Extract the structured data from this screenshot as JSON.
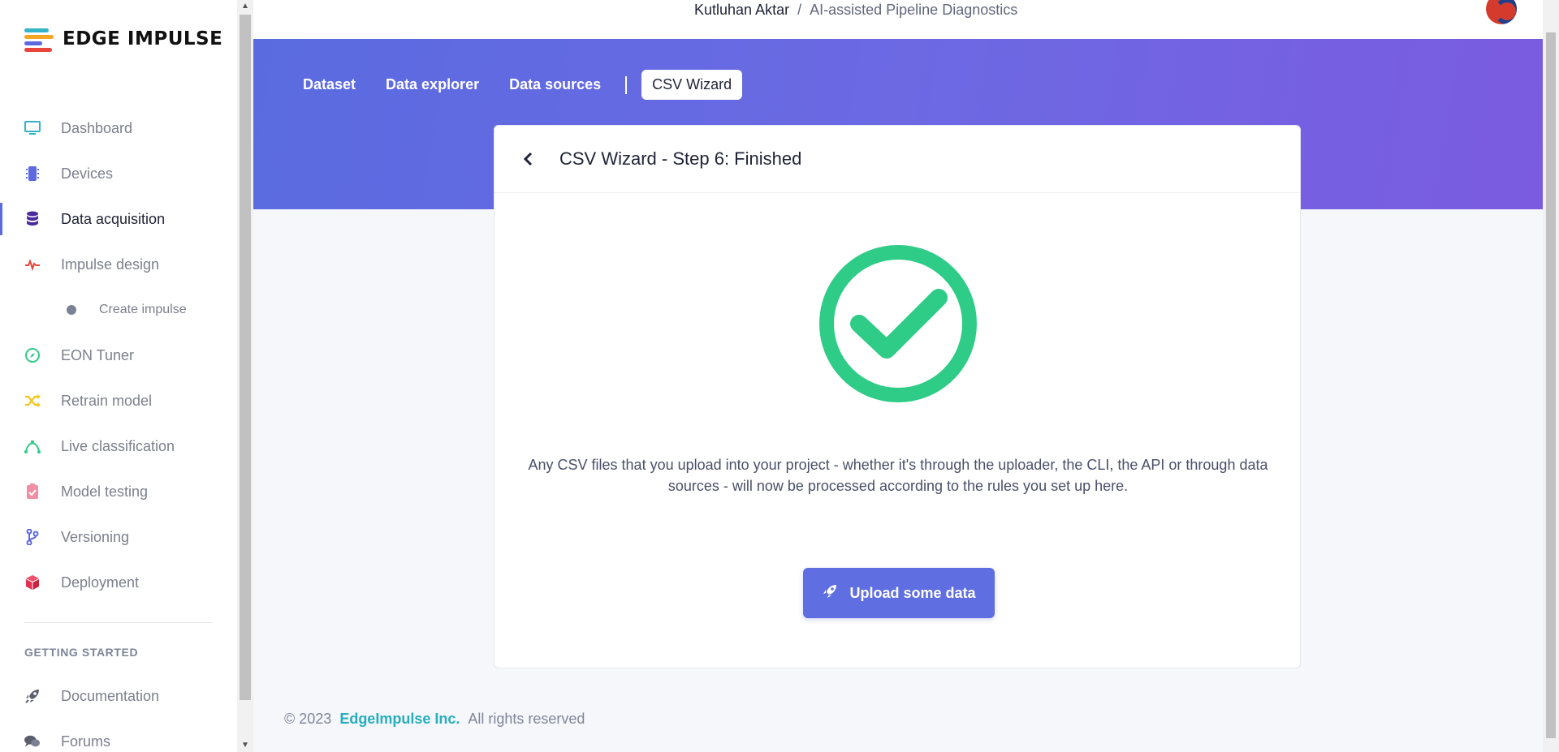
{
  "brand": {
    "name": "EDGE IMPULSE"
  },
  "header": {
    "owner": "Kutluhan Aktar",
    "separator": "/",
    "project": "AI-assisted Pipeline Diagnostics"
  },
  "sidebar": {
    "items": [
      {
        "label": "Dashboard",
        "icon": "monitor-icon"
      },
      {
        "label": "Devices",
        "icon": "chip-icon"
      },
      {
        "label": "Data acquisition",
        "icon": "database-icon"
      },
      {
        "label": "Impulse design",
        "icon": "pulse-icon"
      },
      {
        "label": "Create impulse",
        "icon": "dot-icon"
      },
      {
        "label": "EON Tuner",
        "icon": "compass-icon"
      },
      {
        "label": "Retrain model",
        "icon": "shuffle-icon"
      },
      {
        "label": "Live classification",
        "icon": "bezier-icon"
      },
      {
        "label": "Model testing",
        "icon": "clipboard-check-icon"
      },
      {
        "label": "Versioning",
        "icon": "branch-icon"
      },
      {
        "label": "Deployment",
        "icon": "cube-icon"
      }
    ],
    "section_title": "GETTING STARTED",
    "getting_started": [
      {
        "label": "Documentation",
        "icon": "rocket-icon"
      },
      {
        "label": "Forums",
        "icon": "chat-icon"
      }
    ]
  },
  "tabs": [
    {
      "label": "Dataset"
    },
    {
      "label": "Data explorer"
    },
    {
      "label": "Data sources"
    },
    {
      "label": "CSV Wizard"
    }
  ],
  "card": {
    "title": "CSV Wizard - Step 6: Finished",
    "description": "Any CSV files that you upload into your project - whether it's through the uploader, the CLI, the API or through data sources - will now be processed according to the rules you set up here.",
    "button_label": "Upload some data"
  },
  "footer": {
    "copyright": "© 2023",
    "company": "EdgeImpulse Inc.",
    "rights": "All rights reserved"
  },
  "colors": {
    "accent": "#5f6ee0",
    "success": "#2ecc87",
    "link": "#27aebd"
  }
}
